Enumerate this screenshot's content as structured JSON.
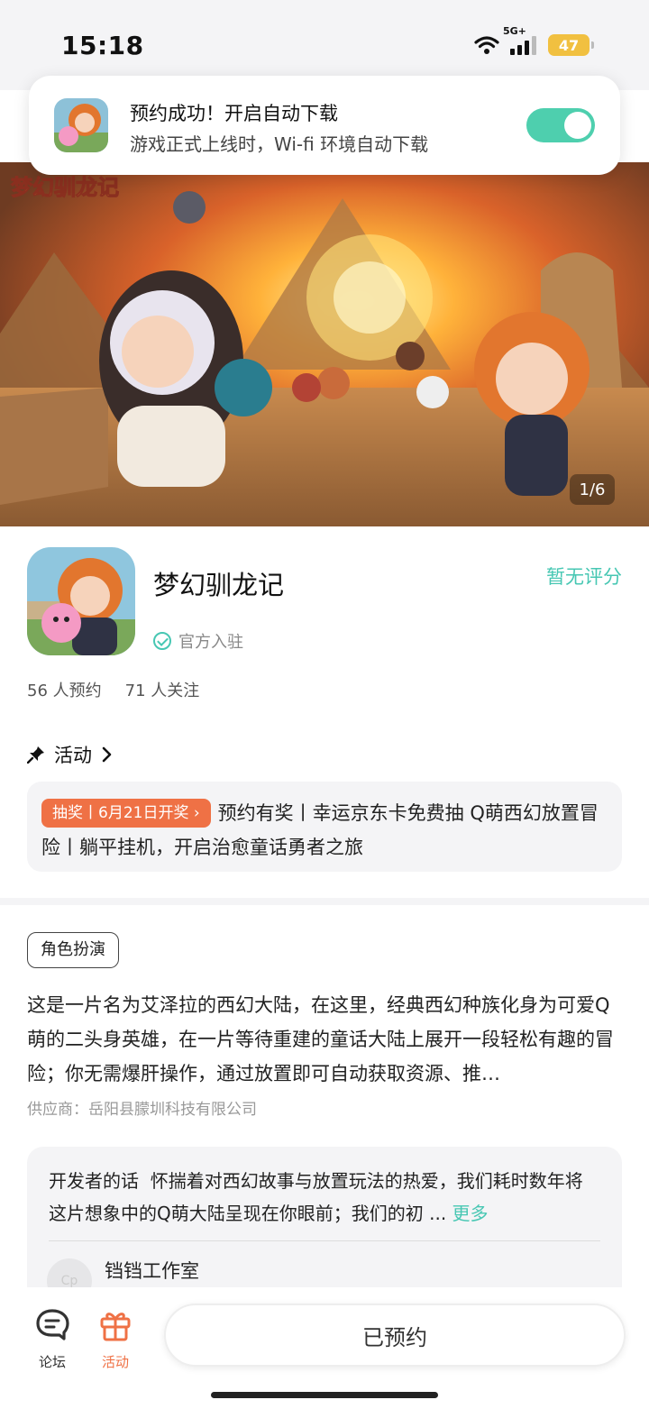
{
  "status_bar": {
    "time": "15:18",
    "network": "5G+",
    "battery": "47"
  },
  "notice": {
    "title": "预约成功！开启自动下载",
    "subtitle": "游戏正式上线时，Wi-fi 环境自动下载",
    "toggle_on": true
  },
  "hero": {
    "logo_text": "梦幻驯龙记",
    "counter": "1/6"
  },
  "app": {
    "name": "梦幻驯龙记",
    "rating": "暂无评分",
    "verified": "官方入驻",
    "reservations": "56 人预约",
    "followers": "71 人关注"
  },
  "activity": {
    "heading": "活动",
    "tag": "抽奖丨6月21日开奖",
    "text": "预约有奖丨幸运京东卡免费抽 Q萌西幻放置冒险丨躺平挂机，开启治愈童话勇者之旅"
  },
  "details": {
    "genre": "角色扮演",
    "description": "这是一片名为艾泽拉的西幻大陆，在这里，经典西幻种族化身为可爱Q萌的二头身英雄，在一片等待重建的童话大陆上展开一段轻松有趣的冒险；你无需爆肝操作，通过放置即可自动获取资源、推…",
    "supplier": "供应商：岳阳县朦圳科技有限公司"
  },
  "developer": {
    "label": "开发者的话",
    "text": "怀揣着对西幻故事与放置玩法的热爱，我们耗时数年将这片想象中的Q萌大陆呈现在你眼前；我们的初 ...",
    "more": "更多",
    "studio": "铛铛工作室",
    "avatar_text": "Cp"
  },
  "bottom_nav": {
    "forum": "论坛",
    "activity": "活动",
    "reserved_button": "已预约"
  },
  "colors": {
    "accent": "#47c7b3",
    "toggle": "#4ecfae",
    "orange": "#ef7145"
  }
}
